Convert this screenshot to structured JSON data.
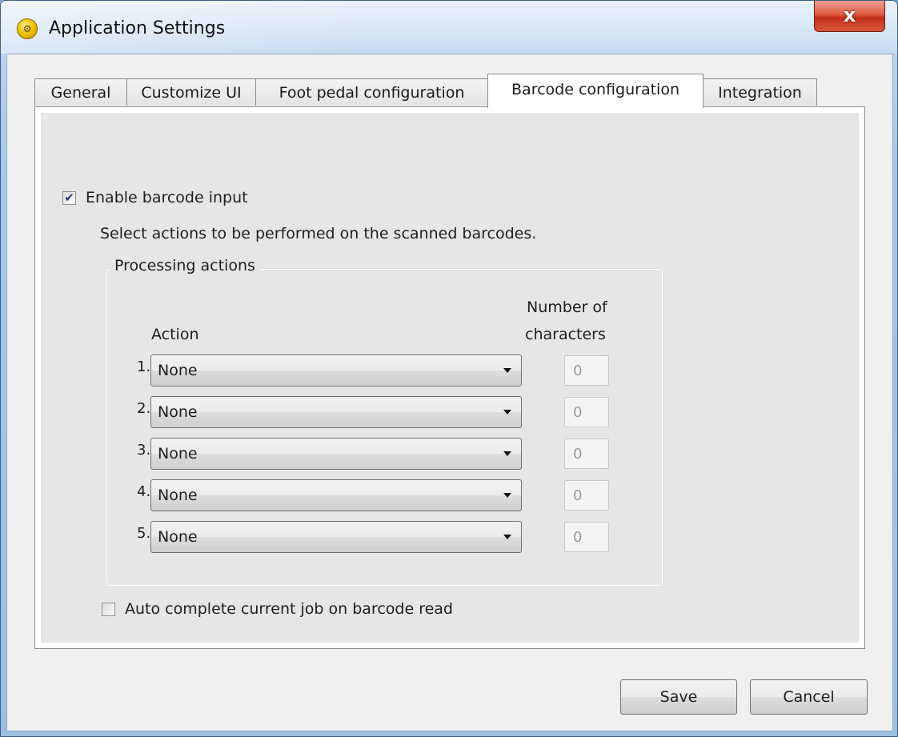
{
  "window": {
    "title": "Application Settings",
    "close_glyph": "x"
  },
  "tabs": [
    {
      "label": "General"
    },
    {
      "label": "Customize UI"
    },
    {
      "label": "Foot pedal configuration"
    },
    {
      "label": "Barcode configuration",
      "active": true
    },
    {
      "label": "Integration"
    }
  ],
  "barcode": {
    "enable_label": "Enable barcode input",
    "enable_checked": true,
    "description": "Select actions to be performed on the scanned barcodes.",
    "group_title": "Processing actions",
    "col_action": "Action",
    "col_chars_line1": "Number of",
    "col_chars_line2": "characters",
    "rows": [
      {
        "num": "1.",
        "action": "None",
        "chars": "0"
      },
      {
        "num": "2.",
        "action": "None",
        "chars": "0"
      },
      {
        "num": "3.",
        "action": "None",
        "chars": "0"
      },
      {
        "num": "4.",
        "action": "None",
        "chars": "0"
      },
      {
        "num": "5.",
        "action": "None",
        "chars": "0"
      }
    ],
    "auto_complete_label": "Auto complete current job on barcode read",
    "auto_complete_checked": false
  },
  "buttons": {
    "save": "Save",
    "cancel": "Cancel"
  },
  "icons": {
    "app": "app-settings-icon",
    "checkmark": "checkmark-icon",
    "dropdown": "chevron-down-icon"
  }
}
